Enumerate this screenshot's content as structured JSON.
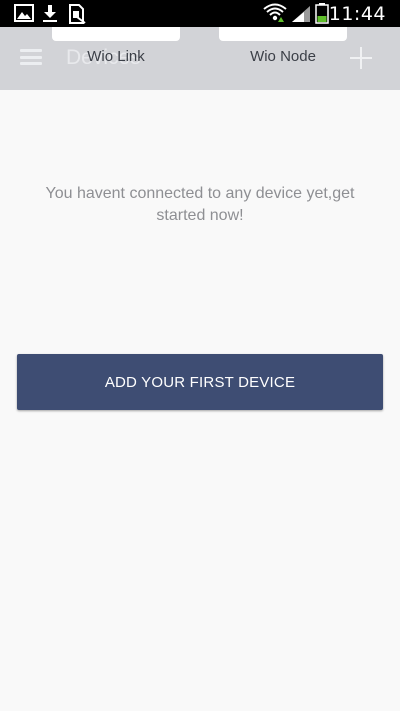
{
  "status_bar": {
    "time": "11:44",
    "icons": [
      "gallery-icon",
      "download-icon",
      "sim-card-icon",
      "wifi-icon",
      "signal-icon",
      "battery-icon"
    ]
  },
  "app_bar": {
    "title": "Devices",
    "menu_icon": "hamburger-menu-icon",
    "add_icon": "plus-icon"
  },
  "device_options": [
    {
      "label": "Wio Link"
    },
    {
      "label": "Wio Node"
    }
  ],
  "main": {
    "empty_message": "You havent connected to any device yet,get started now!",
    "cta_label": "ADD YOUR FIRST DEVICE"
  },
  "colors": {
    "status_bar_bg": "#000000",
    "app_bar_dimmed": "#d2d3d7",
    "primary_button": "#3e4d73",
    "page_bg": "#f9f9f9",
    "battery_green": "#5fbf2a"
  }
}
